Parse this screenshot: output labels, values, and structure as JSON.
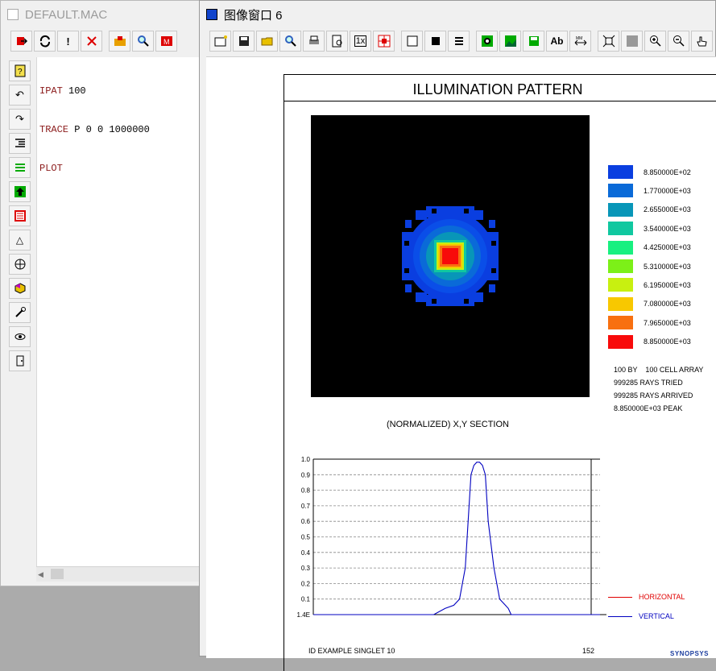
{
  "macro_window": {
    "title": "DEFAULT.MAC",
    "lines": [
      {
        "keyword": "IPAT",
        "args": " 100"
      },
      {
        "keyword": "TRACE",
        "args": " P 0 0 1000000"
      },
      {
        "keyword": "PLOT",
        "args": ""
      }
    ]
  },
  "image_window": {
    "title": "图像窗口 6"
  },
  "plot": {
    "title": "ILLUMINATION PATTERN",
    "legend": [
      {
        "label": "8.850000E+02",
        "color": "#0a3ee0"
      },
      {
        "label": "1.770000E+03",
        "color": "#0a6ad8"
      },
      {
        "label": "2.655000E+03",
        "color": "#0896b8"
      },
      {
        "label": "3.540000E+03",
        "color": "#10c8a0"
      },
      {
        "label": "4.425000E+03",
        "color": "#18f080"
      },
      {
        "label": "5.310000E+03",
        "color": "#7cf018"
      },
      {
        "label": "6.195000E+03",
        "color": "#c8f010"
      },
      {
        "label": "7.080000E+03",
        "color": "#f8c800"
      },
      {
        "label": "7.965000E+03",
        "color": "#f87010"
      },
      {
        "label": "8.850000E+03",
        "color": "#f80a0a"
      }
    ],
    "stats": [
      "100 BY    100 CELL ARRAY",
      "999285 RAYS TRIED",
      "999285 RAYS ARRIVED",
      "8.850000E+03 PEAK"
    ],
    "section_title": "(NORMALIZED) X,Y SECTION",
    "footer_id": "ID EXAMPLE SINGLET 10",
    "footer_number": "152",
    "footer_logo": "SYNOPSYS",
    "section_legend": [
      {
        "label": "HORIZONTAL",
        "color": "#e00000"
      },
      {
        "label": "VERTICAL",
        "color": "#0000c0"
      }
    ]
  },
  "chart_data": {
    "type": "line",
    "title": "(NORMALIZED) X,Y SECTION",
    "xlabel": "",
    "ylabel": "",
    "y_tick_labels": [
      "1.4E",
      "0.1",
      "0.2",
      "0.3",
      "0.4",
      "0.5",
      "0.6",
      "0.7",
      "0.8",
      "0.9",
      "1.0"
    ],
    "ylim": [
      0.0,
      1.0
    ],
    "xlim": [
      0,
      100
    ],
    "grid": true,
    "legend_position": "right",
    "series": [
      {
        "name": "VERTICAL",
        "color": "#0000c0",
        "x": [
          0,
          42,
          46,
          49,
          51,
          53,
          54,
          55,
          56,
          57,
          58,
          59,
          60,
          61,
          63,
          65,
          67,
          68,
          69,
          100
        ],
        "y": [
          0.0,
          0.0,
          0.04,
          0.06,
          0.1,
          0.3,
          0.6,
          0.9,
          0.96,
          0.98,
          0.98,
          0.96,
          0.9,
          0.6,
          0.3,
          0.1,
          0.06,
          0.04,
          0.0,
          0.0
        ]
      },
      {
        "name": "HORIZONTAL",
        "color": "#e00000",
        "x": [],
        "y": []
      }
    ]
  }
}
